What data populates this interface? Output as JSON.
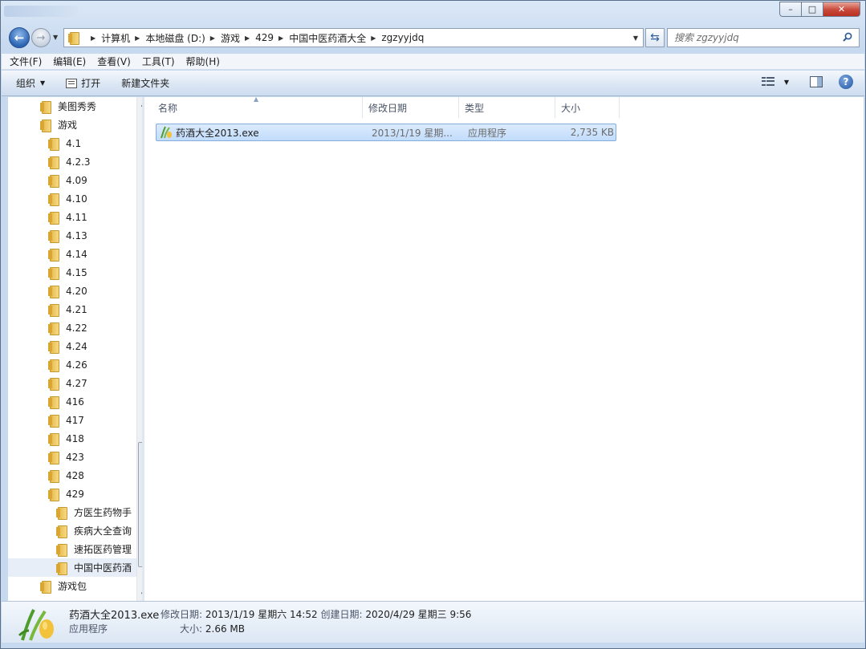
{
  "window": {
    "controls": {
      "minimize": "–",
      "maximize": "□",
      "close": "✕"
    }
  },
  "address": {
    "crumbs": [
      "计算机",
      "本地磁盘 (D:)",
      "游戏",
      "429",
      "中国中医药酒大全",
      "zgzyyjdq"
    ]
  },
  "search": {
    "placeholder": "搜索 zgzyyjdq"
  },
  "menu": [
    "文件(F)",
    "编辑(E)",
    "查看(V)",
    "工具(T)",
    "帮助(H)"
  ],
  "toolbar": {
    "organize": "组织",
    "open": "打开",
    "new_folder": "新建文件夹",
    "help": "?"
  },
  "tree": [
    {
      "label": "美图秀秀",
      "level": 0
    },
    {
      "label": "游戏",
      "level": 0
    },
    {
      "label": "4.1",
      "level": 1
    },
    {
      "label": "4.2.3",
      "level": 1
    },
    {
      "label": "4.09",
      "level": 1
    },
    {
      "label": "4.10",
      "level": 1
    },
    {
      "label": "4.11",
      "level": 1
    },
    {
      "label": "4.13",
      "level": 1
    },
    {
      "label": "4.14",
      "level": 1
    },
    {
      "label": "4.15",
      "level": 1
    },
    {
      "label": "4.20",
      "level": 1
    },
    {
      "label": "4.21",
      "level": 1
    },
    {
      "label": "4.22",
      "level": 1
    },
    {
      "label": "4.24",
      "level": 1
    },
    {
      "label": "4.26",
      "level": 1
    },
    {
      "label": "4.27",
      "level": 1
    },
    {
      "label": "416",
      "level": 1
    },
    {
      "label": "417",
      "level": 1
    },
    {
      "label": "418",
      "level": 1
    },
    {
      "label": "423",
      "level": 1
    },
    {
      "label": "428",
      "level": 1
    },
    {
      "label": "429",
      "level": 1
    },
    {
      "label": "方医生药物手",
      "level": 2
    },
    {
      "label": "疾病大全查询",
      "level": 2
    },
    {
      "label": "速拓医药管理",
      "level": 2
    },
    {
      "label": "中国中医药酒",
      "level": 2,
      "selected": true
    },
    {
      "label": "游戏包",
      "level": 0
    }
  ],
  "columns": {
    "name": "名称",
    "modified": "修改日期",
    "type": "类型",
    "size": "大小"
  },
  "files": [
    {
      "name": "药酒大全2013.exe",
      "modified": "2013/1/19 星期...",
      "type": "应用程序",
      "size": "2,735 KB"
    }
  ],
  "details": {
    "name": "药酒大全2013.exe",
    "modified_label": "修改日期:",
    "modified": "2013/1/19 星期六 14:52",
    "created_label": "创建日期:",
    "created": "2020/4/29 星期三 9:56",
    "type": "应用程序",
    "size_label": "大小:",
    "size": "2.66 MB"
  }
}
